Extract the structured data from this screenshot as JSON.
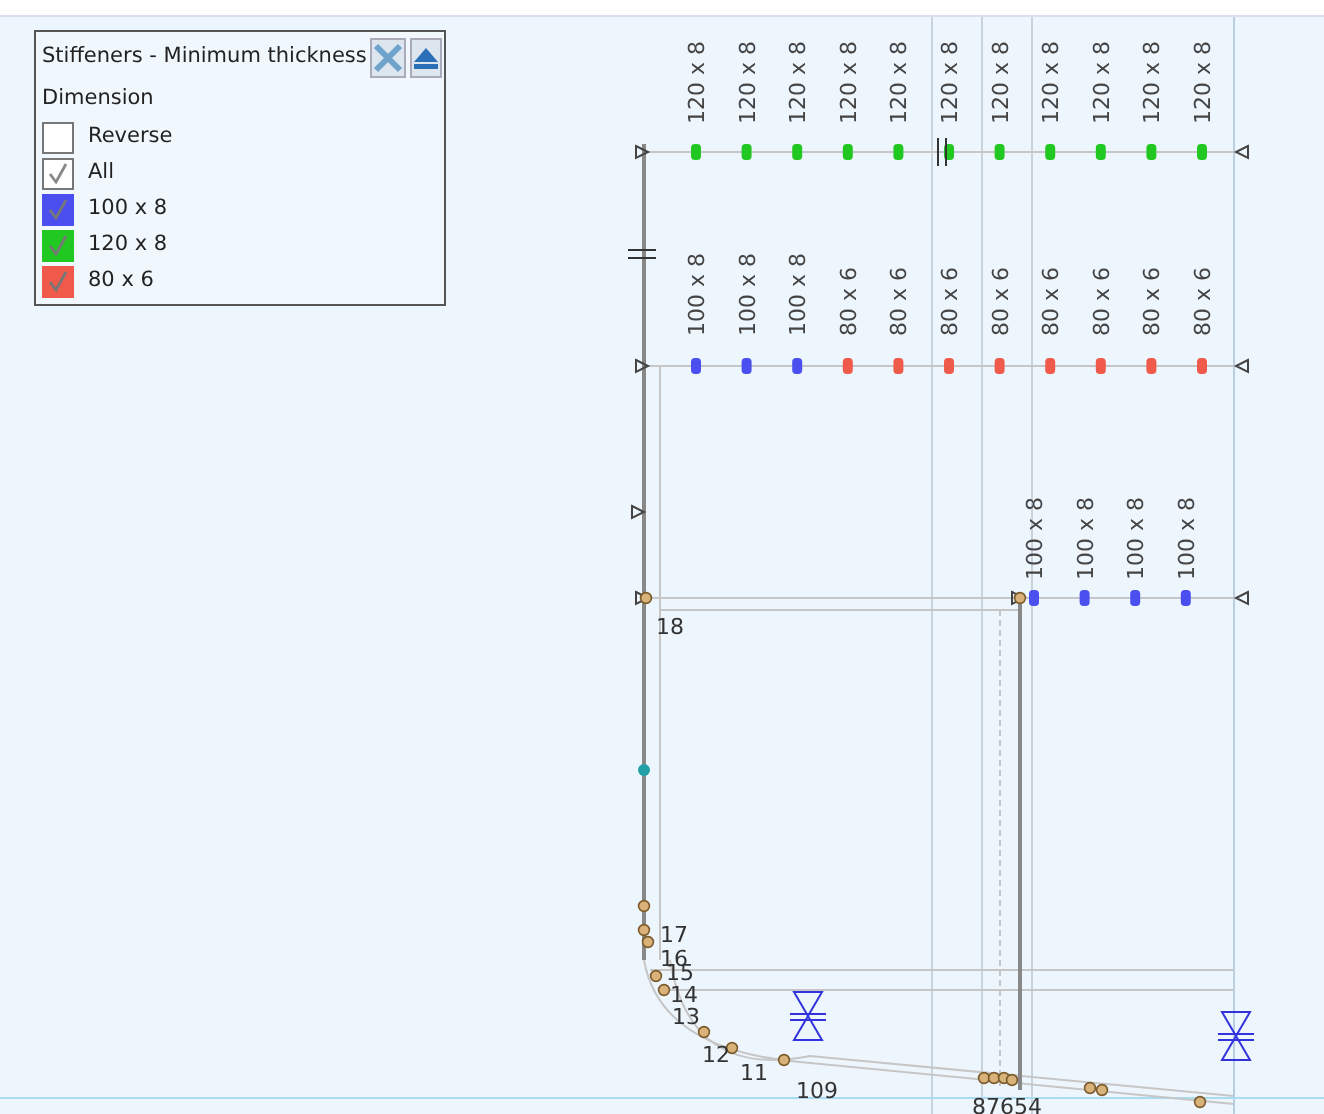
{
  "legend": {
    "title": "Stiffeners - Minimum thickness",
    "heading": "Dimension",
    "items": [
      {
        "label": "Reverse",
        "checked": false
      },
      {
        "label": "All",
        "checked": true
      },
      {
        "label": "100 x 8",
        "checked": true,
        "color": "#4b4ff0"
      },
      {
        "label": "120 x 8",
        "checked": true,
        "color": "#22c822"
      },
      {
        "label": "80 x 6",
        "checked": true,
        "color": "#f05a4a"
      }
    ]
  },
  "stiffener_rows": [
    {
      "stiffeners": [
        {
          "label": "120 x 8",
          "color": "#22c822"
        },
        {
          "label": "120 x 8",
          "color": "#22c822"
        },
        {
          "label": "120 x 8",
          "color": "#22c822"
        },
        {
          "label": "120 x 8",
          "color": "#22c822"
        },
        {
          "label": "120 x 8",
          "color": "#22c822"
        },
        {
          "label": "120 x 8",
          "color": "#22c822"
        },
        {
          "label": "120 x 8",
          "color": "#22c822"
        },
        {
          "label": "120 x 8",
          "color": "#22c822"
        },
        {
          "label": "120 x 8",
          "color": "#22c822"
        },
        {
          "label": "120 x 8",
          "color": "#22c822"
        },
        {
          "label": "120 x 8",
          "color": "#22c822"
        }
      ]
    },
    {
      "stiffeners": [
        {
          "label": "100 x 8",
          "color": "#4b4ff0"
        },
        {
          "label": "100 x 8",
          "color": "#4b4ff0"
        },
        {
          "label": "100 x 8",
          "color": "#4b4ff0"
        },
        {
          "label": "80 x 6",
          "color": "#f05a4a"
        },
        {
          "label": "80 x 6",
          "color": "#f05a4a"
        },
        {
          "label": "80 x 6",
          "color": "#f05a4a"
        },
        {
          "label": "80 x 6",
          "color": "#f05a4a"
        },
        {
          "label": "80 x 6",
          "color": "#f05a4a"
        },
        {
          "label": "80 x 6",
          "color": "#f05a4a"
        },
        {
          "label": "80 x 6",
          "color": "#f05a4a"
        },
        {
          "label": "80 x 6",
          "color": "#f05a4a"
        }
      ]
    },
    {
      "stiffeners": [
        {
          "label": "100 x 8",
          "color": "#4b4ff0"
        },
        {
          "label": "100 x 8",
          "color": "#4b4ff0"
        },
        {
          "label": "100 x 8",
          "color": "#4b4ff0"
        },
        {
          "label": "100 x 8",
          "color": "#4b4ff0"
        }
      ]
    }
  ],
  "node_labels": [
    "18",
    "17",
    "16",
    "15",
    "14",
    "13",
    "12",
    "11",
    "109",
    "87654"
  ]
}
